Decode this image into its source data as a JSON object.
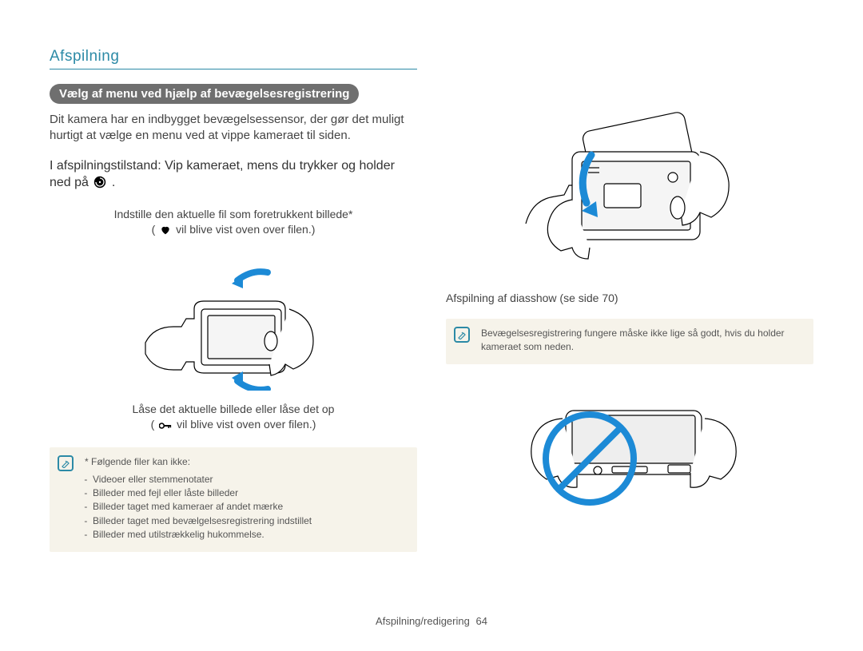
{
  "header": "Afspilning",
  "pill": "Vælg af menu ved hjælp af bevægelsesregistrering",
  "intro": "Dit kamera har en indbygget bevægelsessensor, der gør det muligt hurtigt at vælge en menu ved at vippe kameraet til siden.",
  "instruction_pre": "I afspilningstilstand: Vip kameraet, mens du trykker og holder ned på ",
  "instruction_post": " .",
  "set_fav_line1": "Indstille den aktuelle fil som foretrukkent billede*",
  "set_fav_line2_pre": "(",
  "set_fav_line2_post": " vil blive vist oven over filen.)",
  "lock_line1": "Låse det aktuelle billede eller låse det op",
  "lock_line2_pre": "(",
  "lock_line2_post": " vil blive vist oven over filen.)",
  "note_left_header": "* Følgende filer kan ikke:",
  "note_left_items": [
    "Videoer eller stemmenotater",
    "Billeder med fejl eller låste billeder",
    "Billeder taget med kameraer af andet mærke",
    "Billeder taget med bevælgelsesregistrering indstillet",
    "Billeder med utilstrækkelig hukommelse."
  ],
  "right_caption": "Afspilning af diasshow (se side 70)",
  "note_right": "Bevægelsesregistrering fungere måske ikke lige så godt, hvis du holder kameraet som neden.",
  "footer_text": "Afspilning/redigering",
  "footer_page": "64",
  "icons": {
    "motion_button": "motion-trigger-icon",
    "heart": "heart-icon",
    "key": "key-icon",
    "note": "note-icon"
  }
}
